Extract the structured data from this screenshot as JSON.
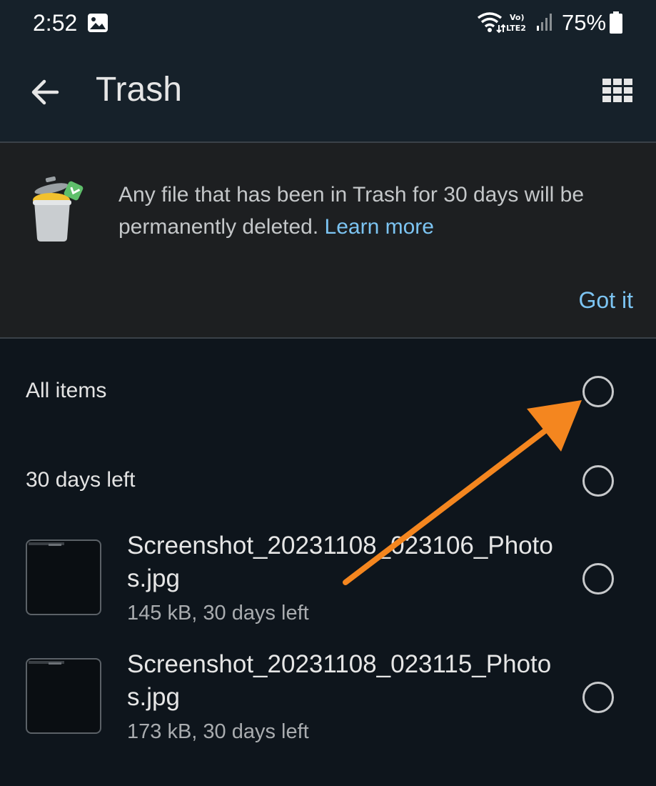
{
  "status_bar": {
    "time": "2:52",
    "volte_label": "Vo) LTE2",
    "battery": "75%",
    "icons": [
      "photo-icon",
      "wifi-icon",
      "volte-icon",
      "signal-icon",
      "battery-icon"
    ]
  },
  "app_bar": {
    "title": "Trash",
    "back_icon": "arrow-back-icon",
    "view_icon": "grid-view-icon"
  },
  "banner": {
    "message": "Any file that has been in Trash for 30 days will be permanently deleted.",
    "link_label": "Learn more",
    "dismiss_label": "Got it",
    "illustration": "trash-can-icon"
  },
  "selection": {
    "all_items_label": "All items",
    "group_label": "30 days left"
  },
  "files": [
    {
      "name": "Screenshot_20231108_023106_Photos.jpg",
      "meta": "145 kB, 30 days left"
    },
    {
      "name": "Screenshot_20231108_023115_Photos.jpg",
      "meta": "173 kB, 30 days left"
    }
  ],
  "annotation": {
    "arrow_color": "#f4861f",
    "target": "all-items-radio"
  },
  "colors": {
    "background": "#0e151c",
    "appbar": "#16212a",
    "banner": "#1d1f21",
    "accent_link": "#7cc4f2"
  }
}
